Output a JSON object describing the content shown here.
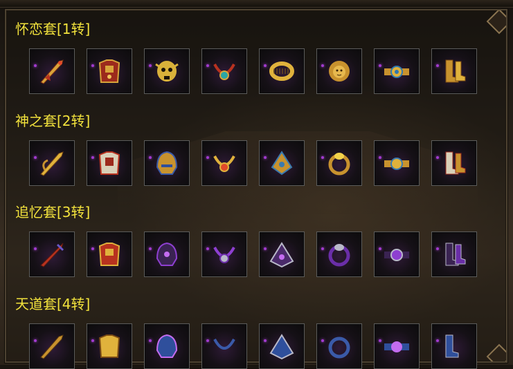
{
  "sections": [
    {
      "title": "怀恋套[1转]",
      "items": [
        "sword-icon",
        "armor-icon",
        "skull-helmet-icon",
        "necklace-icon",
        "bracelet-icon",
        "lion-ring-icon",
        "belt-icon",
        "boots-icon"
      ]
    },
    {
      "title": "神之套[2转]",
      "items": [
        "sword-icon",
        "armor-icon",
        "helmet-icon",
        "necklace-icon",
        "bracelet-icon",
        "ring-icon",
        "belt-icon",
        "boots-icon"
      ]
    },
    {
      "title": "追忆套[3转]",
      "items": [
        "sword-icon",
        "armor-icon",
        "helmet-icon",
        "necklace-icon",
        "bracelet-icon",
        "ring-icon",
        "belt-icon",
        "boots-icon"
      ]
    },
    {
      "title": "天道套[4转]",
      "items": [
        "sword-icon",
        "armor-icon",
        "helmet-icon",
        "necklace-icon",
        "bracelet-icon",
        "ring-icon",
        "belt-icon",
        "boots-icon"
      ]
    }
  ],
  "colors": {
    "title": "#f2e23c",
    "gold": "#d9a43a",
    "red": "#b8321f",
    "purple": "#8e3fd1",
    "silver": "#b9b9c9"
  }
}
